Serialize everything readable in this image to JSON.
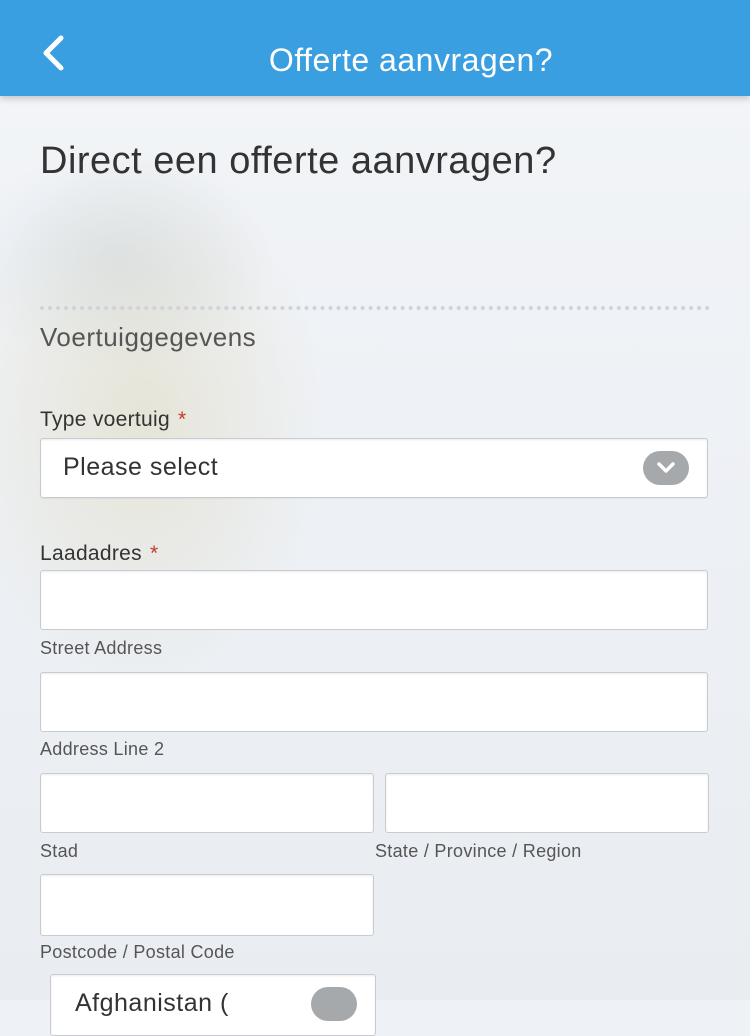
{
  "header": {
    "title": "Offerte aanvragen?",
    "back_icon": "chevron-left-icon",
    "background_color": "#3a9fe0"
  },
  "page": {
    "title": "Direct een offerte aanvragen?",
    "section_title": "Voertuiggegevens"
  },
  "form": {
    "vehicle_type": {
      "label": "Type voertuig",
      "required_marker": "*",
      "selected_value": "Please select"
    },
    "loading_address": {
      "label": "Laadadres",
      "required_marker": "*",
      "street": {
        "sublabel": "Street Address",
        "value": ""
      },
      "line2": {
        "sublabel": "Address Line 2",
        "value": ""
      },
      "city": {
        "sublabel": "Stad",
        "value": ""
      },
      "state": {
        "sublabel": "State / Province / Region",
        "value": ""
      },
      "postal": {
        "sublabel": "Postcode / Postal Code",
        "value": ""
      },
      "country_select": {
        "selected_value": "Afghanistan ("
      }
    }
  }
}
